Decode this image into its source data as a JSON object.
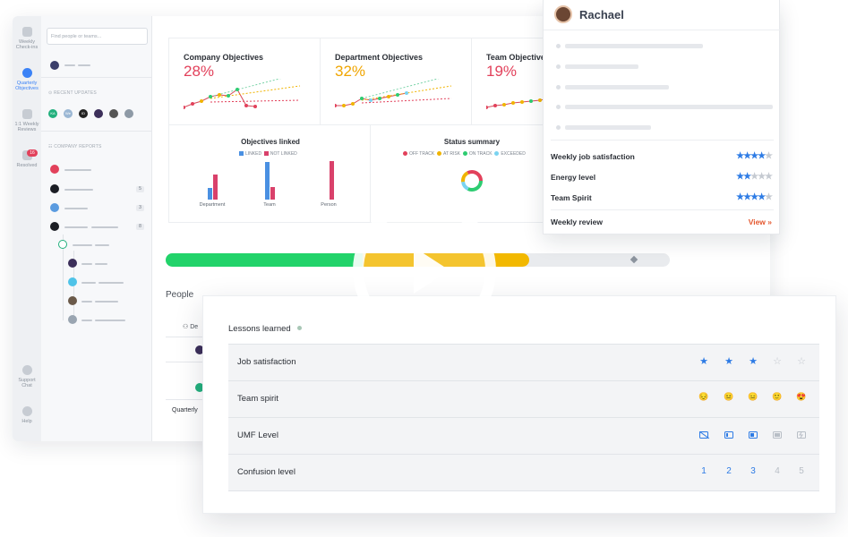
{
  "sidebar_rail": {
    "items": [
      {
        "label": "Weekly Check-ins"
      },
      {
        "label": "Quarterly Objectives"
      },
      {
        "label": "1:1 Weekly Reviews"
      },
      {
        "label": "Resolved",
        "badge": "16"
      },
      {
        "label": "Support Chat"
      },
      {
        "label": "Help"
      }
    ]
  },
  "side_panel": {
    "search_placeholder": "Find people or teams...",
    "recent_updates_label": "RECENT UPDATES",
    "recent_avatars": [
      "KA",
      "We",
      "ID"
    ],
    "company_reports_label": "COMPANY REPORTS",
    "report_counts": [
      "5",
      "3",
      "8"
    ]
  },
  "objectives": [
    {
      "title": "Company Objectives",
      "percent": "28%"
    },
    {
      "title": "Department Objectives",
      "percent": "32%"
    },
    {
      "title": "Team Objectives",
      "percent": "19%"
    }
  ],
  "objectives_linked": {
    "title": "Objectives linked",
    "legend": [
      "LINKED",
      "NOT LINKED"
    ],
    "colors": {
      "linked": "#4a90e2",
      "not_linked": "#d9416b"
    },
    "chart_data": {
      "type": "bar",
      "categories": [
        "Department",
        "Team",
        "Person"
      ],
      "series": [
        {
          "name": "LINKED",
          "values": [
            12,
            40,
            0
          ]
        },
        {
          "name": "NOT LINKED",
          "values": [
            27,
            13,
            41
          ]
        }
      ]
    }
  },
  "status_summary": {
    "title": "Status summary",
    "legend": [
      "OFF TRACK",
      "AT RISK",
      "ON TRACK",
      "EXCEEDED"
    ],
    "colors": [
      "#e2415b",
      "#f0b400",
      "#2ecc71",
      "#7ad3f0"
    ]
  },
  "progress": {
    "green": 0.39,
    "yellow": 0.33,
    "colors": {
      "green": "#22d36a",
      "yellow": "#f2b800",
      "rest": "#e9ebee"
    }
  },
  "people": {
    "heading": "People",
    "col_prefix": "De",
    "row_label": "Quarterly"
  },
  "rachael": {
    "name": "Rachael",
    "metrics": [
      {
        "label": "Weekly job satisfaction",
        "rating": 4,
        "max": 5
      },
      {
        "label": "Energy level",
        "rating": 2,
        "max": 5
      },
      {
        "label": "Team Spirit",
        "rating": 4,
        "max": 5
      }
    ],
    "review_label": "Weekly review",
    "view_link": "View »"
  },
  "lessons": {
    "title": "Lessons learned",
    "rows": [
      {
        "label": "Job satisfaction",
        "kind": "stars",
        "active": 3
      },
      {
        "label": "Team spirit",
        "kind": "emoji",
        "glyphs": [
          "😔",
          "😐",
          "😑",
          "🙂",
          "😍"
        ]
      },
      {
        "label": "UMF Level",
        "kind": "battery"
      },
      {
        "label": "Confusion level",
        "kind": "numbers",
        "values": [
          "1",
          "2",
          "3",
          "4",
          "5"
        ],
        "active": 3
      }
    ]
  }
}
